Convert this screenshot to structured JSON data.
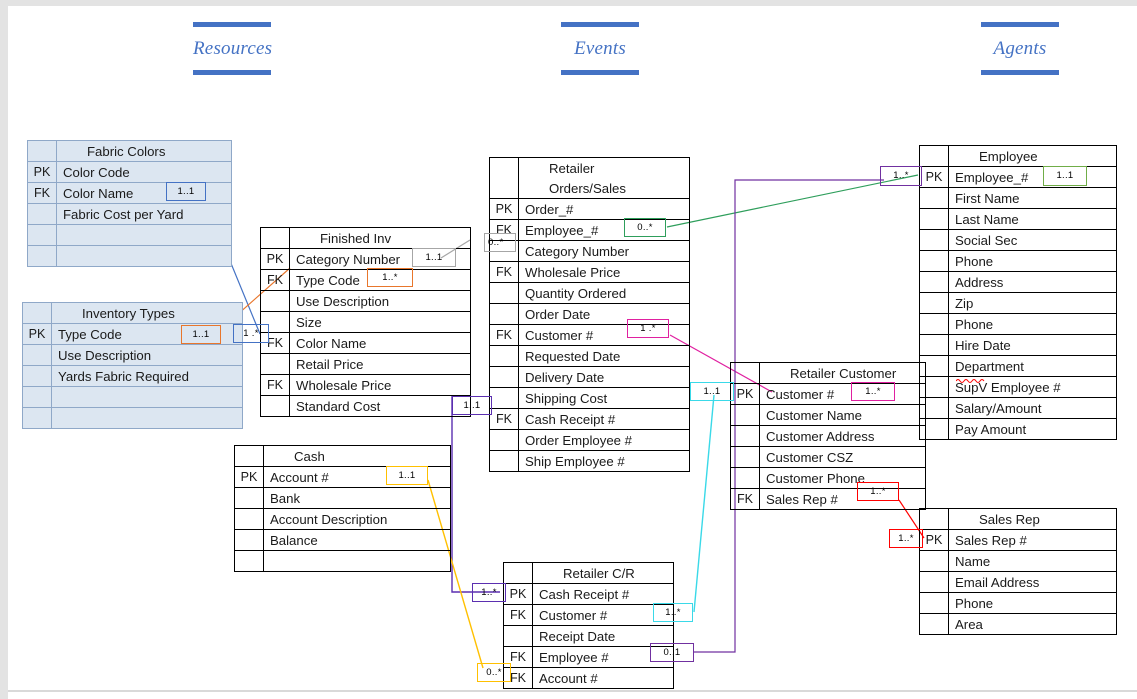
{
  "page": {
    "background_color": "#ffffff",
    "edge_color": "#e3e3e3"
  },
  "sections": [
    {
      "id": "resources",
      "label": "Resources",
      "color": "#4472c4"
    },
    {
      "id": "events",
      "label": "Events",
      "color": "#4472c4"
    },
    {
      "id": "agents",
      "label": "Agents",
      "color": "#4472c4"
    }
  ],
  "entities": [
    {
      "id": "fabric-colors",
      "title": "Fabric Colors",
      "filled": true,
      "rows": [
        {
          "key": "PK",
          "name": "Color Code"
        },
        {
          "key": "FK",
          "name": "Color Name"
        },
        {
          "key": "",
          "name": "Fabric Cost per Yard"
        },
        {
          "key": "",
          "name": ""
        },
        {
          "key": "",
          "name": ""
        }
      ]
    },
    {
      "id": "inventory-types",
      "title": "Inventory Types",
      "filled": true,
      "rows": [
        {
          "key": "PK",
          "name": "Type Code"
        },
        {
          "key": "",
          "name": "Use Description"
        },
        {
          "key": "",
          "name": "Yards Fabric Required"
        },
        {
          "key": "",
          "name": ""
        },
        {
          "key": "",
          "name": ""
        }
      ]
    },
    {
      "id": "finished-inv",
      "title": "Finished Inv",
      "filled": false,
      "rows": [
        {
          "key": "PK",
          "name": "Category Number"
        },
        {
          "key": "FK",
          "name": "Type Code"
        },
        {
          "key": "",
          "name": "Use Description"
        },
        {
          "key": "",
          "name": "Size"
        },
        {
          "key": "FK",
          "name": "Color Name"
        },
        {
          "key": "",
          "name": "Retail Price"
        },
        {
          "key": "FK",
          "name": "Wholesale Price"
        },
        {
          "key": "",
          "name": "Standard Cost"
        }
      ]
    },
    {
      "id": "cash",
      "title": "Cash",
      "filled": false,
      "rows": [
        {
          "key": "PK",
          "name": "Account #"
        },
        {
          "key": "",
          "name": "Bank"
        },
        {
          "key": "",
          "name": "Account Description"
        },
        {
          "key": "",
          "name": "Balance"
        },
        {
          "key": "",
          "name": ""
        }
      ]
    },
    {
      "id": "retailer-orders-sales",
      "title": "Retailer\nOrders/Sales",
      "title_line1": "Retailer",
      "title_line2": "Orders/Sales",
      "filled": false,
      "rows": [
        {
          "key": "PK",
          "name": "Order_#"
        },
        {
          "key": "FK",
          "name": "Employee_#"
        },
        {
          "key": "",
          "name": "Category Number"
        },
        {
          "key": "FK",
          "name": "Wholesale Price"
        },
        {
          "key": "",
          "name": "Quantity Ordered"
        },
        {
          "key": "",
          "name": "Order Date"
        },
        {
          "key": "FK",
          "name": "Customer #"
        },
        {
          "key": "",
          "name": "Requested Date"
        },
        {
          "key": "",
          "name": "Delivery Date"
        },
        {
          "key": "",
          "name": "Shipping Cost"
        },
        {
          "key": "FK",
          "name": "Cash Receipt #"
        },
        {
          "key": "",
          "name": "Order Employee #"
        },
        {
          "key": "",
          "name": "Ship Employee #"
        }
      ]
    },
    {
      "id": "retailer-cr",
      "title": "Retailer C/R",
      "filled": false,
      "rows": [
        {
          "key": "PK",
          "name": "Cash Receipt #"
        },
        {
          "key": "FK",
          "name": "Customer #"
        },
        {
          "key": "",
          "name": "Receipt Date"
        },
        {
          "key": "FK",
          "name": "Employee #"
        },
        {
          "key": "FK",
          "name": "Account #"
        }
      ]
    },
    {
      "id": "retailer-customer",
      "title": "Retailer Customer",
      "filled": false,
      "rows": [
        {
          "key": "PK",
          "name": "Customer #"
        },
        {
          "key": "",
          "name": "Customer Name"
        },
        {
          "key": "",
          "name": "Customer Address"
        },
        {
          "key": "",
          "name": "Customer CSZ"
        },
        {
          "key": "",
          "name": "Customer Phone"
        },
        {
          "key": "FK",
          "name": "Sales Rep #"
        }
      ]
    },
    {
      "id": "employee",
      "title": "Employee",
      "filled": false,
      "rows": [
        {
          "key": "PK",
          "name": "Employee_#"
        },
        {
          "key": "",
          "name": "First Name"
        },
        {
          "key": "",
          "name": "Last Name"
        },
        {
          "key": "",
          "name": "Social Sec"
        },
        {
          "key": "",
          "name": "Phone"
        },
        {
          "key": "",
          "name": "Address"
        },
        {
          "key": "",
          "name": "Zip"
        },
        {
          "key": "",
          "name": "Phone"
        },
        {
          "key": "",
          "name": "Hire Date"
        },
        {
          "key": "",
          "name": "Department"
        },
        {
          "key": "",
          "name": "SupV Employee #"
        },
        {
          "key": "",
          "name": "Salary/Amount"
        },
        {
          "key": "",
          "name": "Pay Amount"
        }
      ]
    },
    {
      "id": "sales-rep",
      "title": "Sales Rep",
      "filled": false,
      "rows": [
        {
          "key": "PK",
          "name": "Sales Rep #"
        },
        {
          "key": "",
          "name": "Name"
        },
        {
          "key": "",
          "name": "Email Address"
        },
        {
          "key": "",
          "name": "Phone"
        },
        {
          "key": "",
          "name": "Area"
        }
      ]
    }
  ],
  "cardinalities": [
    {
      "id": "c-blue-fabric",
      "label": "1..1",
      "color": "#4472c4"
    },
    {
      "id": "c-blue-finished",
      "label": "1 .*",
      "color": "#4472c4"
    },
    {
      "id": "c-orange-inv",
      "label": "1..1",
      "color": "#e8762c"
    },
    {
      "id": "c-orange-finished",
      "label": "1..*",
      "color": "#e8762c"
    },
    {
      "id": "c-grey-finished",
      "label": "1..1",
      "color": "#a6a6a6"
    },
    {
      "id": "c-grey-orders",
      "label": "0..*",
      "color": "#a6a6a6"
    },
    {
      "id": "c-green-orders",
      "label": "0..*",
      "color": "#2e9e5b"
    },
    {
      "id": "c-green-employee",
      "label": "1..1",
      "color": "#70ad47"
    },
    {
      "id": "c-pink-orders",
      "label": "1 .*",
      "color": "#e020a0"
    },
    {
      "id": "c-pink-customer",
      "label": "1..*",
      "color": "#e020a0"
    },
    {
      "id": "c-purple-orders",
      "label": "1..1",
      "color": "#5b2fb0"
    },
    {
      "id": "c-purple-cr",
      "label": "1..*",
      "color": "#5b2fb0"
    },
    {
      "id": "c-purple-emp",
      "label": "1..*",
      "color": "#7030a0"
    },
    {
      "id": "c-purple-cremp",
      "label": "0..1",
      "color": "#7030a0"
    },
    {
      "id": "c-cyan-customer",
      "label": "1..1",
      "color": "#3ad9e8"
    },
    {
      "id": "c-cyan-cr",
      "label": "1..*",
      "color": "#3ad9e8"
    },
    {
      "id": "c-yellow-cash",
      "label": "1..1",
      "color": "#ffc000"
    },
    {
      "id": "c-yellow-cr",
      "label": "0..*",
      "color": "#ffc000"
    },
    {
      "id": "c-red-customer",
      "label": "1..*",
      "color": "#ff0000"
    },
    {
      "id": "c-red-salesrep",
      "label": "1..*",
      "color": "#ff0000"
    }
  ],
  "connector_colors": {
    "fabric_to_finished": "#4472c4",
    "inventory_to_finished": "#e8762c",
    "finished_to_orders": "#a6a6a6",
    "orders_to_employee": "#2e9e5b",
    "orders_to_customer": "#e020a0",
    "orders_to_cr": "#5b2fb0",
    "cr_to_employee": "#7030a0",
    "customer_to_cr": "#3ad9e8",
    "cash_to_cr": "#ffc000",
    "customer_to_salesrep": "#ff0000"
  }
}
